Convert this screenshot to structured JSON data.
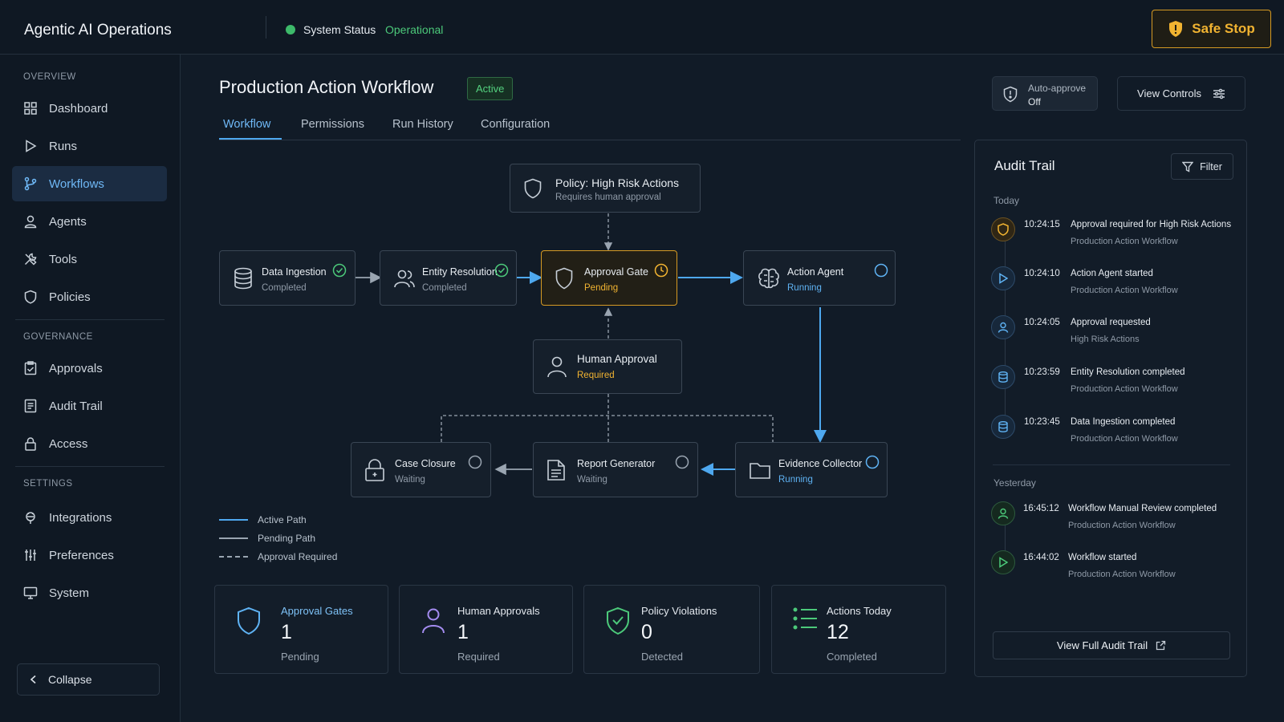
{
  "app": {
    "title": "Agentic AI Operations",
    "status_label": "System Status",
    "status_value": "Operational",
    "safe_stop_label": "Safe Stop"
  },
  "colors": {
    "accent_blue": "#4ea8ef",
    "warning_amber": "#f1b331",
    "success_green": "#4cc97a",
    "background": "#111b27"
  },
  "sidebar": {
    "sections": [
      {
        "label": "OVERVIEW"
      },
      {
        "label": "GOVERNANCE"
      },
      {
        "label": "SETTINGS"
      }
    ],
    "items": [
      {
        "label": "Dashboard",
        "icon": "grid-icon"
      },
      {
        "label": "Runs",
        "icon": "play-icon"
      },
      {
        "label": "Workflows",
        "icon": "branch-icon",
        "active": true
      },
      {
        "label": "Agents",
        "icon": "user-icon"
      },
      {
        "label": "Tools",
        "icon": "tools-icon"
      },
      {
        "label": "Policies",
        "icon": "shield-icon"
      },
      {
        "label": "Approvals",
        "icon": "clipboard-check-icon"
      },
      {
        "label": "Audit Trail",
        "icon": "document-icon"
      },
      {
        "label": "Access",
        "icon": "lock-icon"
      },
      {
        "label": "Integrations",
        "icon": "plug-icon"
      },
      {
        "label": "Preferences",
        "icon": "sliders-icon"
      },
      {
        "label": "System",
        "icon": "monitor-icon"
      }
    ],
    "collapse_label": "Collapse"
  },
  "header": {
    "title": "Production Action Workflow",
    "badge": "Active",
    "auto_approve_label": "Auto-approve",
    "auto_approve_value": "Off",
    "view_controls_label": "View Controls"
  },
  "tabs": [
    {
      "label": "Workflow",
      "active": true
    },
    {
      "label": "Permissions"
    },
    {
      "label": "Run History"
    },
    {
      "label": "Configuration"
    }
  ],
  "workflow": {
    "policy": {
      "title": "Policy: High Risk Actions",
      "subtitle": "Requires human approval",
      "icon": "shield-icon"
    },
    "nodes": {
      "data_ingestion": {
        "title": "Data Ingestion",
        "status": "Completed",
        "icon": "database-icon"
      },
      "entity_resolution": {
        "title": "Entity Resolution",
        "status": "Completed",
        "icon": "users-icon"
      },
      "approval_gate": {
        "title": "Approval Gate",
        "status": "Pending",
        "icon": "shield-icon"
      },
      "action_agent": {
        "title": "Action Agent",
        "status": "Running",
        "icon": "brain-icon"
      },
      "human_approval": {
        "title": "Human Approval",
        "status": "Required",
        "icon": "user-icon"
      },
      "case_closure": {
        "title": "Case Closure",
        "status": "Waiting",
        "icon": "lock-icon"
      },
      "report_generator": {
        "title": "Report Generator",
        "status": "Waiting",
        "icon": "document-icon"
      },
      "evidence_collector": {
        "title": "Evidence Collector",
        "status": "Running",
        "icon": "folder-icon"
      }
    },
    "legend": [
      {
        "label": "Active Path"
      },
      {
        "label": "Pending Path"
      },
      {
        "label": "Approval Required"
      }
    ]
  },
  "stats": [
    {
      "label": "Approval Gates",
      "value": "1",
      "sub": "Pending",
      "icon": "shield-icon"
    },
    {
      "label": "Human Approvals",
      "value": "1",
      "sub": "Required",
      "icon": "user-icon"
    },
    {
      "label": "Policy Violations",
      "value": "0",
      "sub": "Detected",
      "icon": "shield-check-icon"
    },
    {
      "label": "Actions Today",
      "value": "12",
      "sub": "Completed",
      "icon": "list-icon"
    }
  ],
  "audit": {
    "title": "Audit Trail",
    "filter_label": "Filter",
    "today_label": "Today",
    "yesterday_label": "Yesterday",
    "today": [
      {
        "time": "10:24:15",
        "title": "Approval required for High Risk Actions",
        "sub": "Production Action Workflow",
        "icon": "shield-icon"
      },
      {
        "time": "10:24:10",
        "title": "Action Agent started",
        "sub": "Production Action Workflow",
        "icon": "play-icon"
      },
      {
        "time": "10:24:05",
        "title": "Approval requested",
        "sub": "High Risk Actions",
        "icon": "user-icon"
      },
      {
        "time": "10:23:59",
        "title": "Entity Resolution completed",
        "sub": "Production Action Workflow",
        "icon": "database-icon"
      },
      {
        "time": "10:23:45",
        "title": "Data Ingestion completed",
        "sub": "Production Action Workflow",
        "icon": "database-icon"
      }
    ],
    "yesterday": [
      {
        "time": "16:45:12",
        "title": "Workflow Manual Review completed",
        "sub": "Production Action Workflow",
        "icon": "user-icon"
      },
      {
        "time": "16:44:02",
        "title": "Workflow started",
        "sub": "Production Action Workflow",
        "icon": "play-icon"
      }
    ],
    "view_full_label": "View Full Audit Trail"
  }
}
